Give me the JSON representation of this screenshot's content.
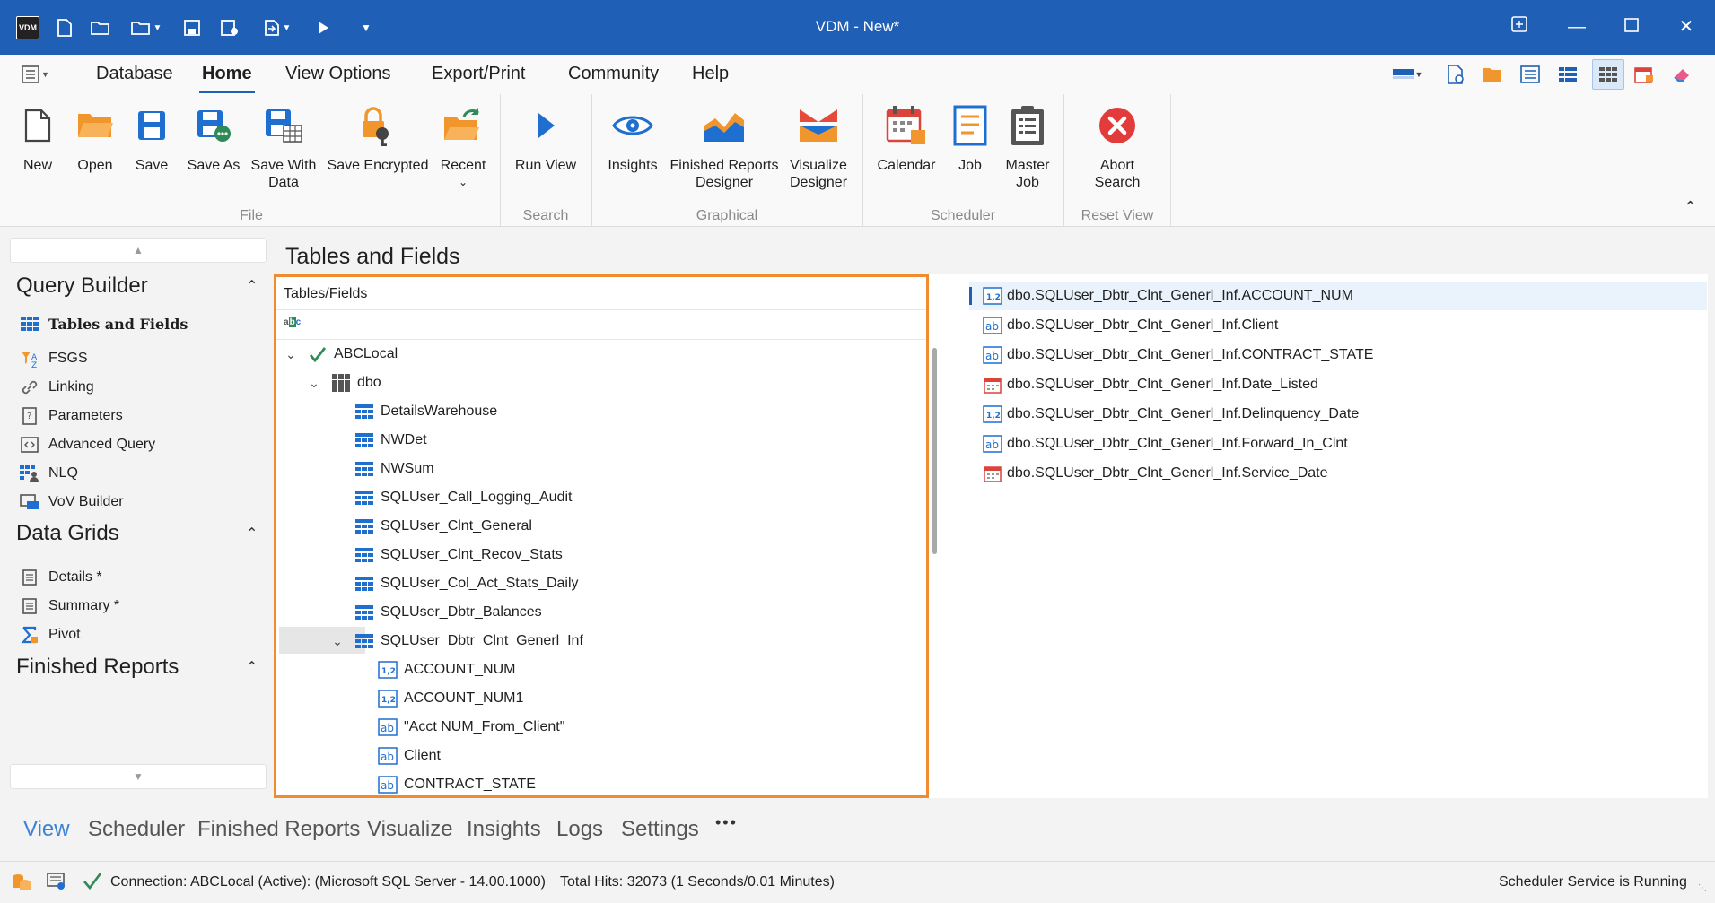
{
  "titlebar": {
    "title": "VDM - New*",
    "logo_text": "VDM"
  },
  "menubar": {
    "items": [
      "Database",
      "Home",
      "View Options",
      "Export/Print",
      "Community",
      "Help"
    ],
    "active": "Home"
  },
  "ribbon": {
    "buttons": {
      "new": "New",
      "open": "Open",
      "save": "Save",
      "save_as": "Save As",
      "save_with_data_1": "Save With",
      "save_with_data_2": "Data",
      "save_encrypted": "Save Encrypted",
      "recent": "Recent",
      "run_view": "Run View",
      "insights": "Insights",
      "finished_reports_1": "Finished Reports",
      "finished_reports_2": "Designer",
      "visualize_1": "Visualize",
      "visualize_2": "Designer",
      "calendar": "Calendar",
      "job": "Job",
      "master_job_1": "Master",
      "master_job_2": "Job",
      "abort_search_1": "Abort",
      "abort_search_2": "Search"
    },
    "groups": {
      "file": "File",
      "search": "Search",
      "graphical": "Graphical",
      "scheduler": "Scheduler",
      "reset_view": "Reset View"
    }
  },
  "leftpanel": {
    "query_builder": {
      "title": "Query Builder",
      "items": [
        "Tables and Fields",
        "FSGS",
        "Linking",
        "Parameters",
        "Advanced Query",
        "NLQ",
        "VoV Builder"
      ]
    },
    "data_grids": {
      "title": "Data Grids",
      "items": [
        "Details *",
        "Summary *",
        "Pivot"
      ]
    },
    "finished_reports": {
      "title": "Finished Reports"
    }
  },
  "main": {
    "title": "Tables and Fields",
    "tree_header": "Tables/Fields",
    "tree": {
      "connection": "ABCLocal",
      "schema": "dbo",
      "tables": [
        "DetailsWarehouse",
        "NWDet",
        "NWSum",
        "SQLUser_Call_Logging_Audit",
        "SQLUser_Clnt_General",
        "SQLUser_Clnt_Recov_Stats",
        "SQLUser_Col_Act_Stats_Daily",
        "SQLUser_Dbtr_Balances",
        "SQLUser_Dbtr_Clnt_Generl_Inf"
      ],
      "fields": [
        "ACCOUNT_NUM",
        "ACCOUNT_NUM1",
        "\"Acct NUM_From_Client\"",
        "Client",
        "CONTRACT_STATE"
      ]
    },
    "selected_fields": [
      "dbo.SQLUser_Dbtr_Clnt_Generl_Inf.ACCOUNT_NUM",
      "dbo.SQLUser_Dbtr_Clnt_Generl_Inf.Client",
      "dbo.SQLUser_Dbtr_Clnt_Generl_Inf.CONTRACT_STATE",
      "dbo.SQLUser_Dbtr_Clnt_Generl_Inf.Date_Listed",
      "dbo.SQLUser_Dbtr_Clnt_Generl_Inf.Delinquency_Date",
      "dbo.SQLUser_Dbtr_Clnt_Generl_Inf.Forward_In_Clnt",
      "dbo.SQLUser_Dbtr_Clnt_Generl_Inf.Service_Date"
    ]
  },
  "bottom_tabs": {
    "items": [
      "View",
      "Scheduler",
      "Finished Reports",
      "Visualize",
      "Insights",
      "Logs",
      "Settings"
    ],
    "more": "•••",
    "active": "View"
  },
  "statusbar": {
    "connection": "Connection: ABCLocal (Active): (Microsoft SQL Server - 14.00.1000)",
    "hits": "Total Hits: 32073 (1 Seconds/0.01 Minutes)",
    "scheduler": "Scheduler Service is Running"
  },
  "colors": {
    "accent": "#1f5fb5",
    "highlight": "#f08c2d",
    "icon_blue": "#1f6fd1",
    "icon_orange": "#f0962d"
  }
}
